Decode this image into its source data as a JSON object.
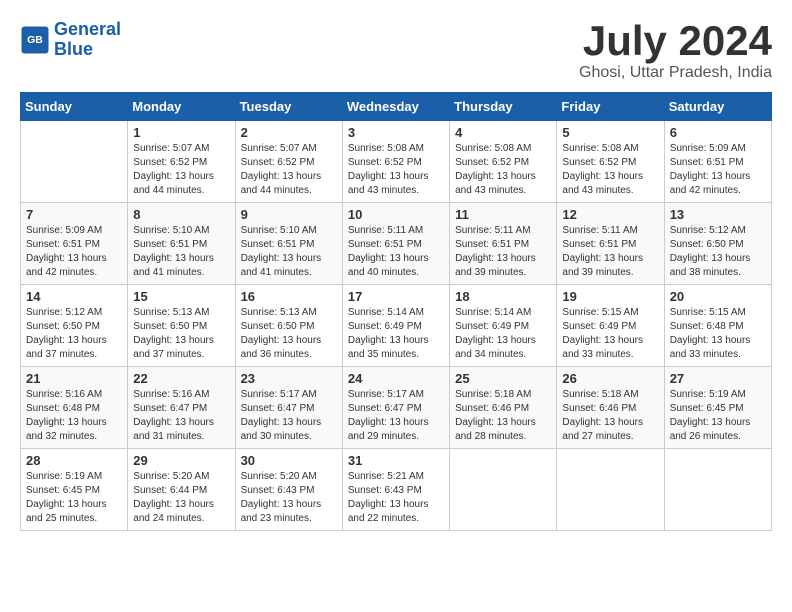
{
  "header": {
    "logo_line1": "General",
    "logo_line2": "Blue",
    "month_title": "July 2024",
    "location": "Ghosi, Uttar Pradesh, India"
  },
  "days_of_week": [
    "Sunday",
    "Monday",
    "Tuesday",
    "Wednesday",
    "Thursday",
    "Friday",
    "Saturday"
  ],
  "weeks": [
    [
      {
        "day": null
      },
      {
        "day": 1,
        "sunrise": "5:07 AM",
        "sunset": "6:52 PM",
        "daylight": "13 hours and 44 minutes."
      },
      {
        "day": 2,
        "sunrise": "5:07 AM",
        "sunset": "6:52 PM",
        "daylight": "13 hours and 44 minutes."
      },
      {
        "day": 3,
        "sunrise": "5:08 AM",
        "sunset": "6:52 PM",
        "daylight": "13 hours and 43 minutes."
      },
      {
        "day": 4,
        "sunrise": "5:08 AM",
        "sunset": "6:52 PM",
        "daylight": "13 hours and 43 minutes."
      },
      {
        "day": 5,
        "sunrise": "5:08 AM",
        "sunset": "6:52 PM",
        "daylight": "13 hours and 43 minutes."
      },
      {
        "day": 6,
        "sunrise": "5:09 AM",
        "sunset": "6:51 PM",
        "daylight": "13 hours and 42 minutes."
      }
    ],
    [
      {
        "day": 7,
        "sunrise": "5:09 AM",
        "sunset": "6:51 PM",
        "daylight": "13 hours and 42 minutes."
      },
      {
        "day": 8,
        "sunrise": "5:10 AM",
        "sunset": "6:51 PM",
        "daylight": "13 hours and 41 minutes."
      },
      {
        "day": 9,
        "sunrise": "5:10 AM",
        "sunset": "6:51 PM",
        "daylight": "13 hours and 41 minutes."
      },
      {
        "day": 10,
        "sunrise": "5:11 AM",
        "sunset": "6:51 PM",
        "daylight": "13 hours and 40 minutes."
      },
      {
        "day": 11,
        "sunrise": "5:11 AM",
        "sunset": "6:51 PM",
        "daylight": "13 hours and 39 minutes."
      },
      {
        "day": 12,
        "sunrise": "5:11 AM",
        "sunset": "6:51 PM",
        "daylight": "13 hours and 39 minutes."
      },
      {
        "day": 13,
        "sunrise": "5:12 AM",
        "sunset": "6:50 PM",
        "daylight": "13 hours and 38 minutes."
      }
    ],
    [
      {
        "day": 14,
        "sunrise": "5:12 AM",
        "sunset": "6:50 PM",
        "daylight": "13 hours and 37 minutes."
      },
      {
        "day": 15,
        "sunrise": "5:13 AM",
        "sunset": "6:50 PM",
        "daylight": "13 hours and 37 minutes."
      },
      {
        "day": 16,
        "sunrise": "5:13 AM",
        "sunset": "6:50 PM",
        "daylight": "13 hours and 36 minutes."
      },
      {
        "day": 17,
        "sunrise": "5:14 AM",
        "sunset": "6:49 PM",
        "daylight": "13 hours and 35 minutes."
      },
      {
        "day": 18,
        "sunrise": "5:14 AM",
        "sunset": "6:49 PM",
        "daylight": "13 hours and 34 minutes."
      },
      {
        "day": 19,
        "sunrise": "5:15 AM",
        "sunset": "6:49 PM",
        "daylight": "13 hours and 33 minutes."
      },
      {
        "day": 20,
        "sunrise": "5:15 AM",
        "sunset": "6:48 PM",
        "daylight": "13 hours and 33 minutes."
      }
    ],
    [
      {
        "day": 21,
        "sunrise": "5:16 AM",
        "sunset": "6:48 PM",
        "daylight": "13 hours and 32 minutes."
      },
      {
        "day": 22,
        "sunrise": "5:16 AM",
        "sunset": "6:47 PM",
        "daylight": "13 hours and 31 minutes."
      },
      {
        "day": 23,
        "sunrise": "5:17 AM",
        "sunset": "6:47 PM",
        "daylight": "13 hours and 30 minutes."
      },
      {
        "day": 24,
        "sunrise": "5:17 AM",
        "sunset": "6:47 PM",
        "daylight": "13 hours and 29 minutes."
      },
      {
        "day": 25,
        "sunrise": "5:18 AM",
        "sunset": "6:46 PM",
        "daylight": "13 hours and 28 minutes."
      },
      {
        "day": 26,
        "sunrise": "5:18 AM",
        "sunset": "6:46 PM",
        "daylight": "13 hours and 27 minutes."
      },
      {
        "day": 27,
        "sunrise": "5:19 AM",
        "sunset": "6:45 PM",
        "daylight": "13 hours and 26 minutes."
      }
    ],
    [
      {
        "day": 28,
        "sunrise": "5:19 AM",
        "sunset": "6:45 PM",
        "daylight": "13 hours and 25 minutes."
      },
      {
        "day": 29,
        "sunrise": "5:20 AM",
        "sunset": "6:44 PM",
        "daylight": "13 hours and 24 minutes."
      },
      {
        "day": 30,
        "sunrise": "5:20 AM",
        "sunset": "6:43 PM",
        "daylight": "13 hours and 23 minutes."
      },
      {
        "day": 31,
        "sunrise": "5:21 AM",
        "sunset": "6:43 PM",
        "daylight": "13 hours and 22 minutes."
      },
      {
        "day": null
      },
      {
        "day": null
      },
      {
        "day": null
      }
    ]
  ]
}
